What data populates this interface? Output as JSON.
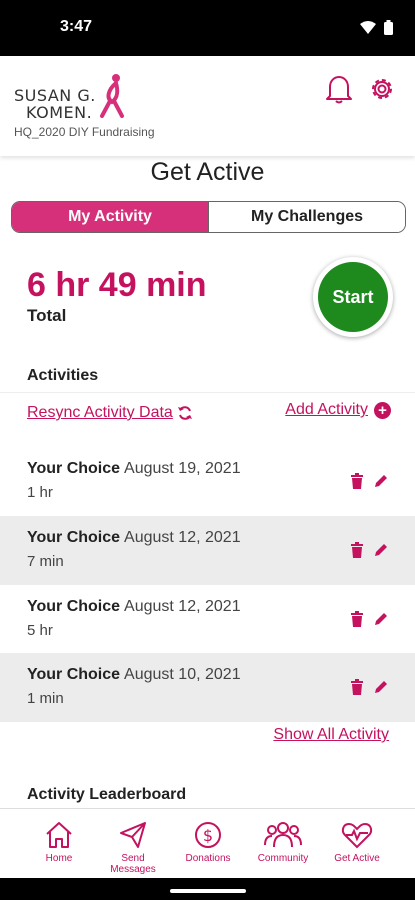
{
  "status_bar": {
    "time": "3:47"
  },
  "header": {
    "logo_line1": "SUSAN G.",
    "logo_line2": "KOMEN.",
    "campaign": "HQ_2020 DIY Fundraising"
  },
  "page_title": "Get Active",
  "tabs": [
    {
      "label": "My Activity",
      "active": true
    },
    {
      "label": "My Challenges",
      "active": false
    }
  ],
  "summary": {
    "total_time": "6 hr 49 min",
    "total_label": "Total",
    "start_label": "Start"
  },
  "activities_section": {
    "title": "Activities",
    "resync_label": "Resync Activity Data",
    "add_label": "Add Activity",
    "items": [
      {
        "name": "Your Choice",
        "date": "August 19, 2021",
        "duration": "1 hr"
      },
      {
        "name": "Your Choice",
        "date": "August 12, 2021",
        "duration": "7 min"
      },
      {
        "name": "Your Choice",
        "date": "August 12, 2021",
        "duration": "5 hr"
      },
      {
        "name": "Your Choice",
        "date": "August 10, 2021",
        "duration": "1 min"
      }
    ],
    "show_all_label": "Show All Activity"
  },
  "leaderboard": {
    "title": "Activity Leaderboard"
  },
  "bottom_nav": [
    {
      "label": "Home",
      "icon": "home-icon"
    },
    {
      "label": "Send Messages",
      "icon": "paper-plane-icon"
    },
    {
      "label": "Donations",
      "icon": "dollar-circle-icon"
    },
    {
      "label": "Community",
      "icon": "people-icon"
    },
    {
      "label": "Get Active",
      "icon": "heartbeat-icon"
    }
  ],
  "colors": {
    "brand": "#c4125f",
    "tab_active": "#d6307a",
    "start": "#1e8a1e"
  }
}
